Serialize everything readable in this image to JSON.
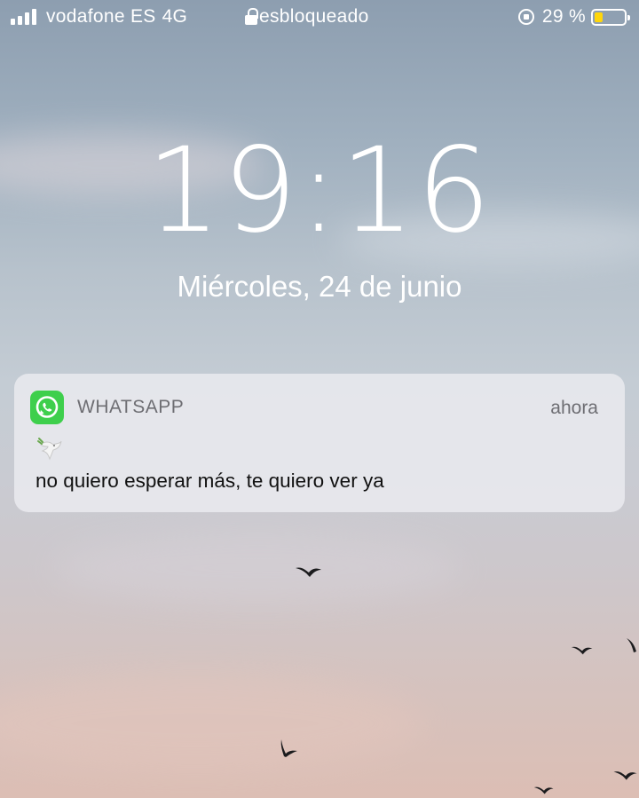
{
  "status_bar": {
    "carrier": "vodafone ES",
    "network": "4G",
    "lock_status": "esbloqueado",
    "battery_percent": "29 %",
    "battery_level": 0.29,
    "battery_color": "#ffd60a"
  },
  "lock_screen": {
    "time": "19:16",
    "date": "Miércoles, 24 de junio"
  },
  "notification": {
    "app_name": "WHATSAPP",
    "timestamp": "ahora",
    "emoji_icon": "dove-icon",
    "message": "no quiero esperar más, te quiero ver ya",
    "app_color": "#3ecf4c"
  }
}
